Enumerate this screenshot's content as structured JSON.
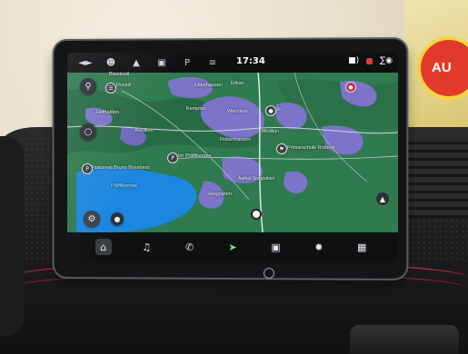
{
  "scene": {
    "description_colors": {
      "map_land": "#2f7a4f",
      "map_urban": "#7b74c9",
      "lake": "#1d86e0",
      "accent_red": "#c8294b"
    },
    "promo_badge_text": "AU"
  },
  "status_bar": {
    "icons": [
      "car-icon",
      "user-icon",
      "location-icon",
      "radio-icon",
      "parking-icon",
      "heated-seat-icon"
    ],
    "clock": "17:34"
  },
  "map": {
    "labels": {
      "baretswil": "Bäretswil",
      "rosinli": "Rosinli",
      "ettenhausen": "Ettenhausen",
      "erikon": "Erikon",
      "kemptthal": "Kempten",
      "wetzikon": "Wetzikon",
      "oli": "Oli",
      "hofhalden": "Hofhalden",
      "auslikon": "Auslikon",
      "robenhausen": "Robenhausen",
      "medikon": "Medikon",
      "primarschule": "Primarschule Robenk",
      "parkplatz": "Parkareal Bruno Bosshard",
      "imp": "Im Pfäffikersee",
      "pfaffikersee": "Pfäffikersee",
      "seegraben": "Seegraben",
      "aathal": "Aathal-Seegraben"
    }
  },
  "dock": {
    "icons": [
      "home-icon",
      "music-icon",
      "phone-icon",
      "navigation-icon",
      "connected-apps-icon",
      "fan-icon",
      "apps-grid-icon"
    ]
  }
}
